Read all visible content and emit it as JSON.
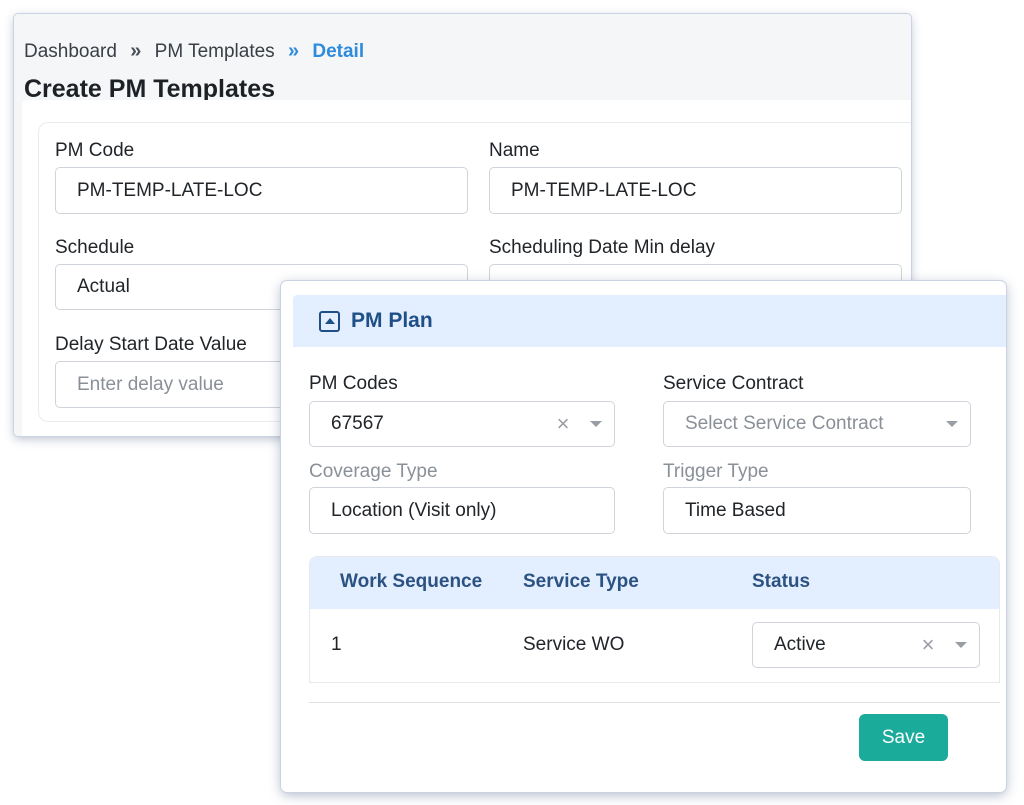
{
  "breadcrumb": {
    "items": [
      "Dashboard",
      "PM Templates"
    ],
    "active": "Detail",
    "separator": "»"
  },
  "page": {
    "title": "Create PM Templates"
  },
  "template_form": {
    "pm_code": {
      "label": "PM Code",
      "value": "PM-TEMP-LATE-LOC"
    },
    "name": {
      "label": "Name",
      "value": "PM-TEMP-LATE-LOC"
    },
    "schedule": {
      "label": "Schedule",
      "value": "Actual"
    },
    "scheduling_delay": {
      "label": "Scheduling Date Min delay"
    },
    "delay_start": {
      "label": "Delay Start Date Value",
      "placeholder": "Enter delay value"
    }
  },
  "pm_plan": {
    "title": "PM Plan",
    "pm_codes": {
      "label": "PM Codes",
      "value": "67567"
    },
    "service_contract": {
      "label": "Service Contract",
      "placeholder": "Select Service Contract"
    },
    "coverage_type": {
      "label": "Coverage Type",
      "value": "Location (Visit only)"
    },
    "trigger_type": {
      "label": "Trigger Type",
      "value": "Time Based"
    },
    "table": {
      "headers": [
        "Work Sequence",
        "Service Type",
        "Status"
      ],
      "rows": [
        {
          "sequence": "1",
          "service_type": "Service WO",
          "status": "Active"
        }
      ]
    },
    "save_label": "Save"
  },
  "icons": {
    "clear": "×",
    "breadcrumb_separator": "»"
  },
  "colors": {
    "accent": "#2f8bdc",
    "header_bg": "#e3efff",
    "header_text": "#1f4f86",
    "save": "#1aab9b"
  }
}
